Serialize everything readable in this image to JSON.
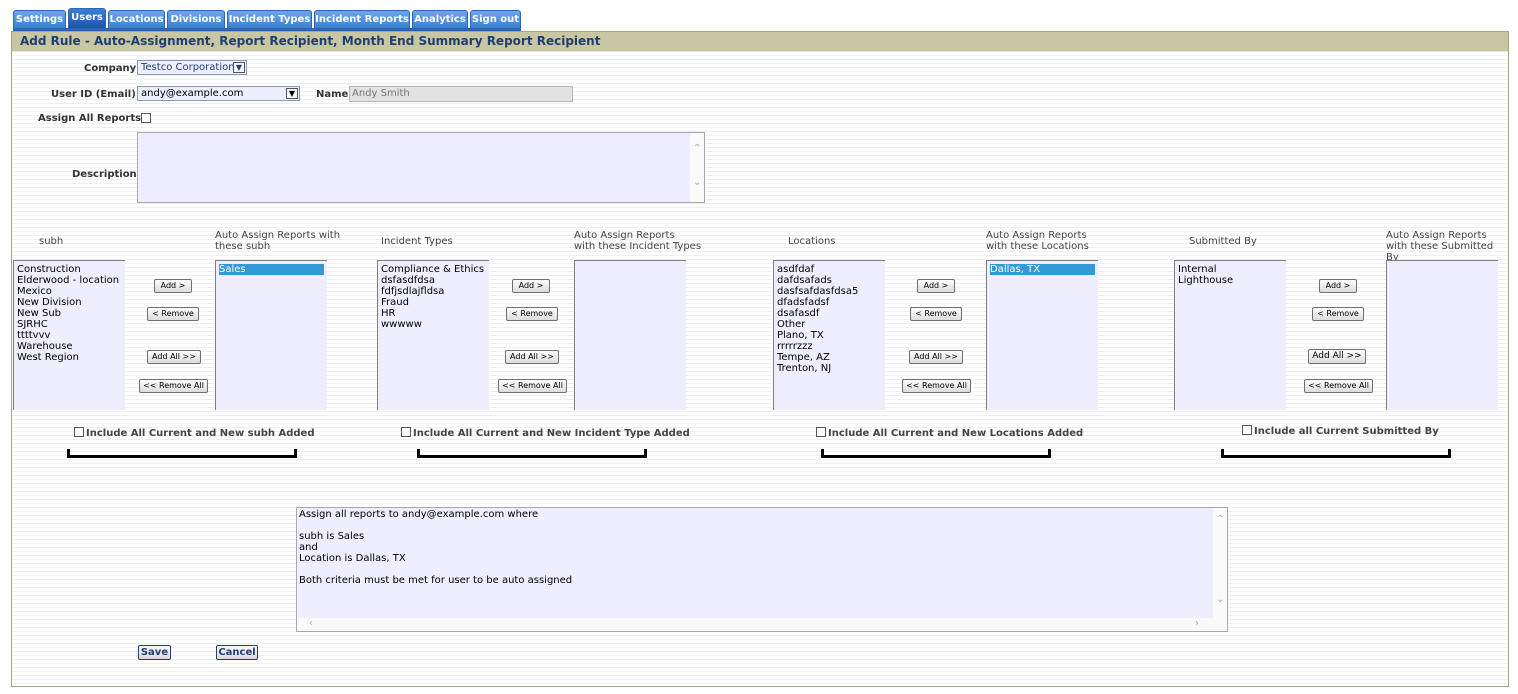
{
  "tabs": [
    "Settings",
    "Users",
    "Locations",
    "Divisions",
    "Incident Types",
    "Incident Reports",
    "Analytics",
    "Sign out"
  ],
  "header_title": "Add Rule - Auto-Assignment, Report Recipient, Month End Summary Report Recipient",
  "form": {
    "company_label": "Company",
    "company_value": "Testco Corporation",
    "userid_label": "User ID (Email)",
    "userid_value": "andy@example.com",
    "name_label": "Name",
    "name_value": "Andy Smith",
    "assign_all_label": "Assign All Reports",
    "description_label": "Description"
  },
  "groups": [
    {
      "avail_header": "subh",
      "assigned_header_1": "Auto Assign Reports with",
      "assigned_header_2": "these subh",
      "available": [
        "Construction",
        "Elderwood - location",
        "Mexico",
        "New Division",
        "New Sub",
        "SJRHC",
        "ttttvvv",
        "Warehouse",
        "West Region"
      ],
      "assigned": [
        "Sales"
      ],
      "include_label": "Include All Current and New subh Added"
    },
    {
      "avail_header": "Incident Types",
      "assigned_header_1": "Auto Assign Reports",
      "assigned_header_2": "with these Incident Types",
      "available": [
        "Compliance & Ethics",
        "dsfasdfdsa",
        "fdfjsdlajfldsa",
        "Fraud",
        "HR",
        "wwwww"
      ],
      "assigned": [],
      "include_label": "Include All Current and New Incident Type Added"
    },
    {
      "avail_header": "Locations",
      "assigned_header_1": "Auto Assign Reports",
      "assigned_header_2": "with these Locations",
      "available": [
        "asdfdaf",
        "dafdsafads",
        "dasfsafdasfdsa5",
        "dfadsfadsf",
        "dsafasdf",
        "Other",
        "Plano, TX",
        "rrrrrzzz",
        "Tempe, AZ",
        "Trenton, NJ"
      ],
      "assigned": [
        "Dallas, TX"
      ],
      "include_label": "Include All Current and New Locations Added"
    },
    {
      "avail_header": "Submitted By",
      "assigned_header_1": "Auto Assign Reports",
      "assigned_header_2": "with these Submitted By",
      "available": [
        "Internal",
        "Lighthouse"
      ],
      "assigned": [],
      "include_label": "Include all Current Submitted By"
    }
  ],
  "buttons": {
    "add": "Add >",
    "remove": "< Remove",
    "add_all": "Add All >>",
    "remove_all": "<< Remove All",
    "save": "Save",
    "cancel": "Cancel"
  },
  "summary_text": "Assign all reports to andy@example.com where\n\nsubh is Sales\nand\nLocation is Dallas, TX\n\nBoth criteria must be met for user to be auto assigned"
}
